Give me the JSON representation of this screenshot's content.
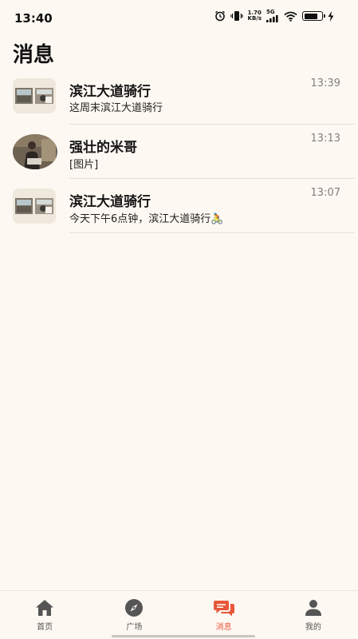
{
  "status_bar": {
    "time": "13:40",
    "net_speed_value": "1.70",
    "net_speed_unit": "KB/s",
    "signal_label": "5G",
    "battery_level": 0.8,
    "icons": [
      "alarm-icon",
      "vibrate-icon",
      "signal-icon",
      "wifi-icon",
      "battery-icon",
      "charging-icon"
    ]
  },
  "page": {
    "title": "消息"
  },
  "messages": [
    {
      "title": "滨江大道骑行",
      "preview": "这周末滨江大道骑行",
      "time": "13:39",
      "avatar": "group-photo"
    },
    {
      "title": "强壮的米哥",
      "preview": "[图片]",
      "time": "13:13",
      "avatar": "user-photo"
    },
    {
      "title": "滨江大道骑行",
      "preview": "今天下午6点钟，滨江大道骑行🚴",
      "time": "13:07",
      "avatar": "group-photo"
    }
  ],
  "nav": {
    "items": [
      {
        "label": "首页",
        "icon": "home-icon"
      },
      {
        "label": "广场",
        "icon": "compass-icon"
      },
      {
        "label": "消息",
        "icon": "chat-icon"
      },
      {
        "label": "我的",
        "icon": "person-icon"
      }
    ],
    "active_index": 2,
    "active_color": "#e8573a",
    "inactive_color": "#555555"
  },
  "colors": {
    "background": "#fdf8f2",
    "time_text": "#808080",
    "divider": "#e6e0d8"
  }
}
